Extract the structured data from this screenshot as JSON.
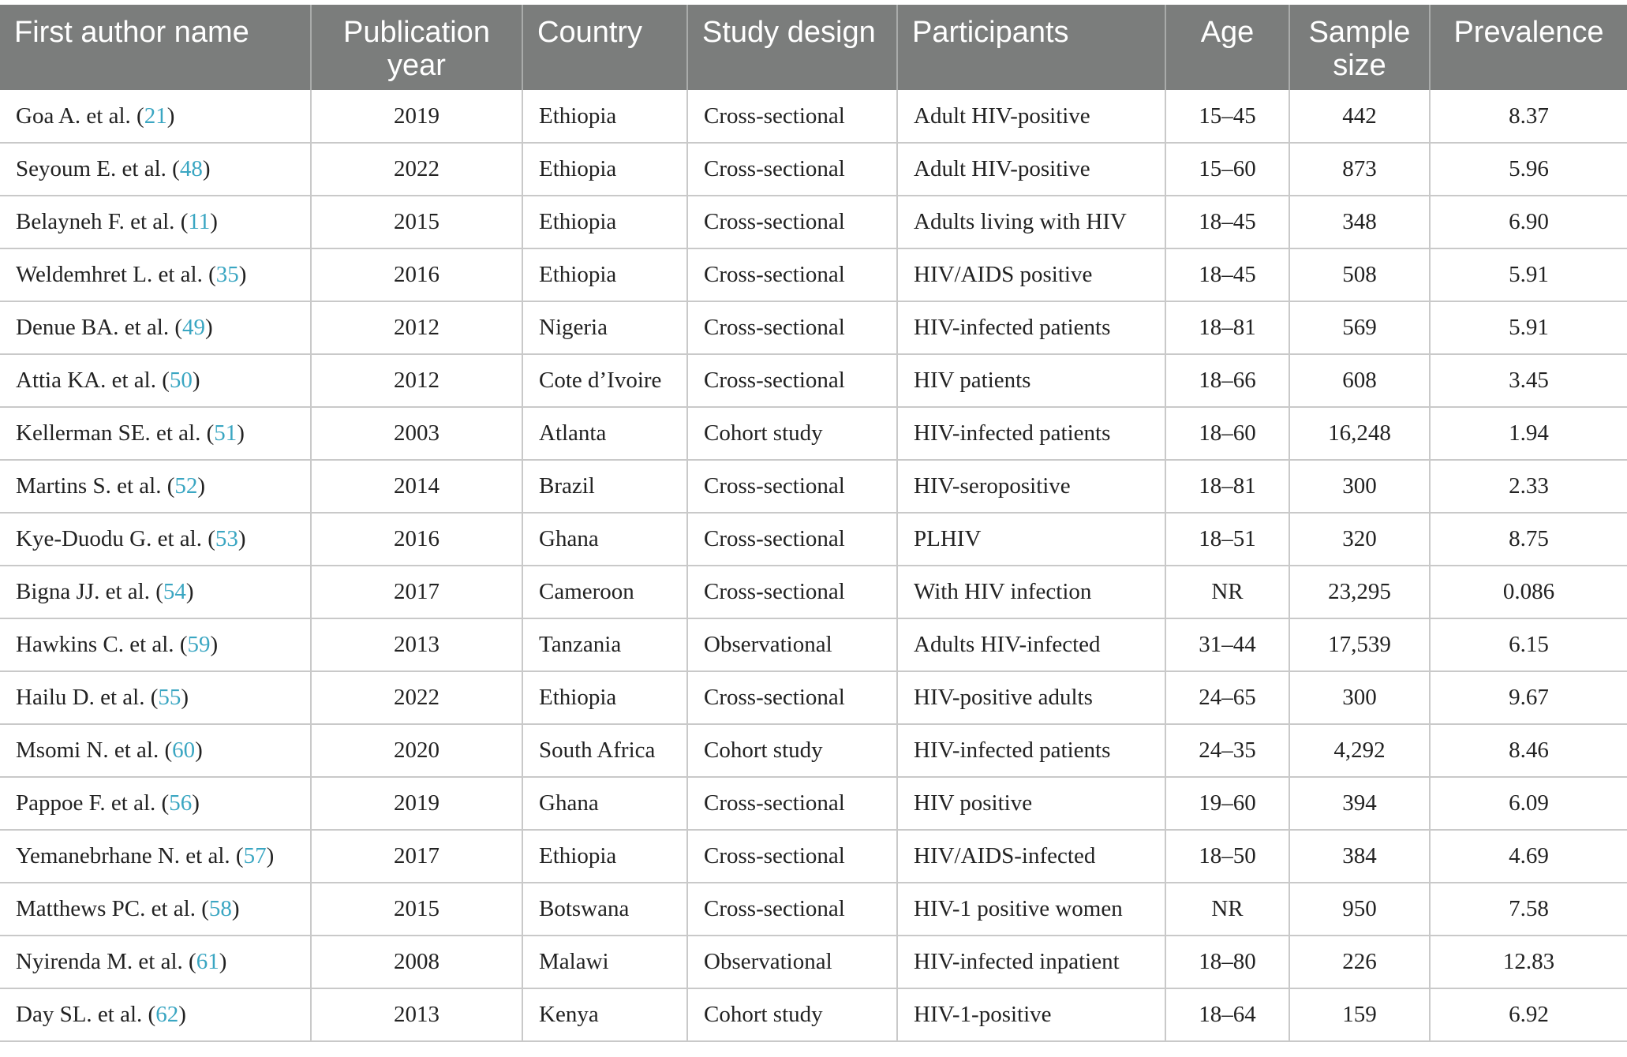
{
  "table": {
    "headers": [
      "First author name",
      "Publication year",
      "Country",
      "Study design",
      "Participants",
      "Age",
      "Sample size",
      "Prevalence"
    ],
    "rows": [
      {
        "author": "Goa A. et al.",
        "ref": "21",
        "year": "2019",
        "country": "Ethiopia",
        "design": "Cross-sectional",
        "participants": "Adult HIV-positive",
        "age": "15–45",
        "sample": "442",
        "prevalence": "8.37"
      },
      {
        "author": "Seyoum E. et al.",
        "ref": "48",
        "year": "2022",
        "country": "Ethiopia",
        "design": "Cross-sectional",
        "participants": "Adult HIV-positive",
        "age": "15–60",
        "sample": "873",
        "prevalence": "5.96"
      },
      {
        "author": "Belayneh F. et al.",
        "ref": "11",
        "year": "2015",
        "country": "Ethiopia",
        "design": "Cross-sectional",
        "participants": "Adults living with HIV",
        "age": "18–45",
        "sample": "348",
        "prevalence": "6.90"
      },
      {
        "author": "Weldemhret L. et al.",
        "ref": "35",
        "year": "2016",
        "country": "Ethiopia",
        "design": "Cross-sectional",
        "participants": "HIV/AIDS positive",
        "age": "18–45",
        "sample": "508",
        "prevalence": "5.91"
      },
      {
        "author": "Denue BA. et al.",
        "ref": "49",
        "year": "2012",
        "country": "Nigeria",
        "design": "Cross-sectional",
        "participants": "HIV-infected patients",
        "age": "18–81",
        "sample": "569",
        "prevalence": "5.91"
      },
      {
        "author": "Attia KA. et al.",
        "ref": "50",
        "year": "2012",
        "country": "Cote d’Ivoire",
        "design": "Cross-sectional",
        "participants": "HIV patients",
        "age": "18–66",
        "sample": "608",
        "prevalence": "3.45"
      },
      {
        "author": "Kellerman SE. et al.",
        "ref": "51",
        "year": "2003",
        "country": "Atlanta",
        "design": "Cohort study",
        "participants": "HIV-infected patients",
        "age": "18–60",
        "sample": "16,248",
        "prevalence": "1.94"
      },
      {
        "author": "Martins S. et al.",
        "ref": "52",
        "year": "2014",
        "country": "Brazil",
        "design": "Cross-sectional",
        "participants": "HIV-seropositive",
        "age": "18–81",
        "sample": "300",
        "prevalence": "2.33"
      },
      {
        "author": "Kye-Duodu G. et al.",
        "ref": "53",
        "year": "2016",
        "country": "Ghana",
        "design": "Cross-sectional",
        "participants": "PLHIV",
        "age": "18–51",
        "sample": "320",
        "prevalence": "8.75"
      },
      {
        "author": "Bigna JJ. et al.",
        "ref": "54",
        "year": "2017",
        "country": "Cameroon",
        "design": "Cross-sectional",
        "participants": "With HIV infection",
        "age": "NR",
        "sample": "23,295",
        "prevalence": "0.086"
      },
      {
        "author": "Hawkins C. et al.",
        "ref": "59",
        "year": "2013",
        "country": "Tanzania",
        "design": "Observational",
        "participants": "Adults HIV-infected",
        "age": "31–44",
        "sample": "17,539",
        "prevalence": "6.15"
      },
      {
        "author": "Hailu D. et al.",
        "ref": "55",
        "year": "2022",
        "country": "Ethiopia",
        "design": "Cross-sectional",
        "participants": "HIV-positive adults",
        "age": "24–65",
        "sample": "300",
        "prevalence": "9.67"
      },
      {
        "author": "Msomi N. et al.",
        "ref": "60",
        "year": "2020",
        "country": "South Africa",
        "design": "Cohort study",
        "participants": "HIV-infected patients",
        "age": "24–35",
        "sample": "4,292",
        "prevalence": "8.46"
      },
      {
        "author": "Pappoe F. et al.",
        "ref": "56",
        "year": "2019",
        "country": "Ghana",
        "design": "Cross-sectional",
        "participants": "HIV positive",
        "age": "19–60",
        "sample": "394",
        "prevalence": "6.09"
      },
      {
        "author": "Yemanebrhane N. et al.",
        "ref": "57",
        "year": "2017",
        "country": "Ethiopia",
        "design": "Cross-sectional",
        "participants": "HIV/AIDS-infected",
        "age": "18–50",
        "sample": "384",
        "prevalence": "4.69"
      },
      {
        "author": "Matthews PC. et al.",
        "ref": "58",
        "year": "2015",
        "country": "Botswana",
        "design": "Cross-sectional",
        "participants": "HIV-1 positive women",
        "age": "NR",
        "sample": "950",
        "prevalence": "7.58"
      },
      {
        "author": "Nyirenda M. et al.",
        "ref": "61",
        "year": "2008",
        "country": "Malawi",
        "design": "Observational",
        "participants": "HIV-infected inpatient",
        "age": "18–80",
        "sample": "226",
        "prevalence": "12.83"
      },
      {
        "author": "Day SL. et al.",
        "ref": "62",
        "year": "2013",
        "country": "Kenya",
        "design": "Cohort study",
        "participants": "HIV-1-positive",
        "age": "18–64",
        "sample": "159",
        "prevalence": "6.92"
      }
    ]
  },
  "colors": {
    "header_bg": "#7b7d7c",
    "header_text": "#ffffff",
    "ref_link": "#3aa6c2",
    "grid": "#c9c9c9"
  }
}
